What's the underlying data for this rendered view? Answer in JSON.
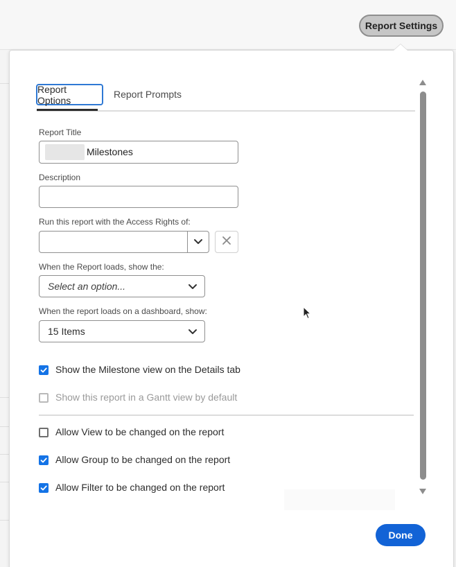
{
  "header": {
    "report_settings_label": "Report Settings"
  },
  "tabs": [
    {
      "label": "Report Options",
      "active": true
    },
    {
      "label": "Report Prompts",
      "active": false
    }
  ],
  "form": {
    "report_title": {
      "label": "Report Title",
      "value": "Milestones"
    },
    "description": {
      "label": "Description",
      "value": ""
    },
    "access_rights": {
      "label": "Run this report with the Access Rights of:",
      "value": ""
    },
    "report_loads": {
      "label": "When the Report loads, show the:",
      "placeholder": "Select an option..."
    },
    "dashboard_loads": {
      "label": "When the report loads on a dashboard, show:",
      "value": "15 Items"
    }
  },
  "checkboxes": [
    {
      "label": "Show the Milestone view on the Details tab",
      "checked": true,
      "disabled": false
    },
    {
      "label": "Show this report in a Gantt view by default",
      "checked": false,
      "disabled": true
    },
    {
      "label": "Allow View to be changed on the report",
      "checked": false,
      "disabled": false
    },
    {
      "label": "Allow Group to be changed on the report",
      "checked": true,
      "disabled": false
    },
    {
      "label": "Allow Filter to be changed on the report",
      "checked": true,
      "disabled": false
    }
  ],
  "footer": {
    "done_label": "Done"
  },
  "colors": {
    "accent": "#1473e6",
    "done_button": "#1263d6",
    "tab_focus": "#2f79d4"
  },
  "icons": {
    "combo_toggle": "chevron-down-icon",
    "clear": "close-icon",
    "select_toggle": "chevron-down-icon",
    "checkmark": "checkmark-icon",
    "pointer": "mouse-cursor-icon"
  }
}
